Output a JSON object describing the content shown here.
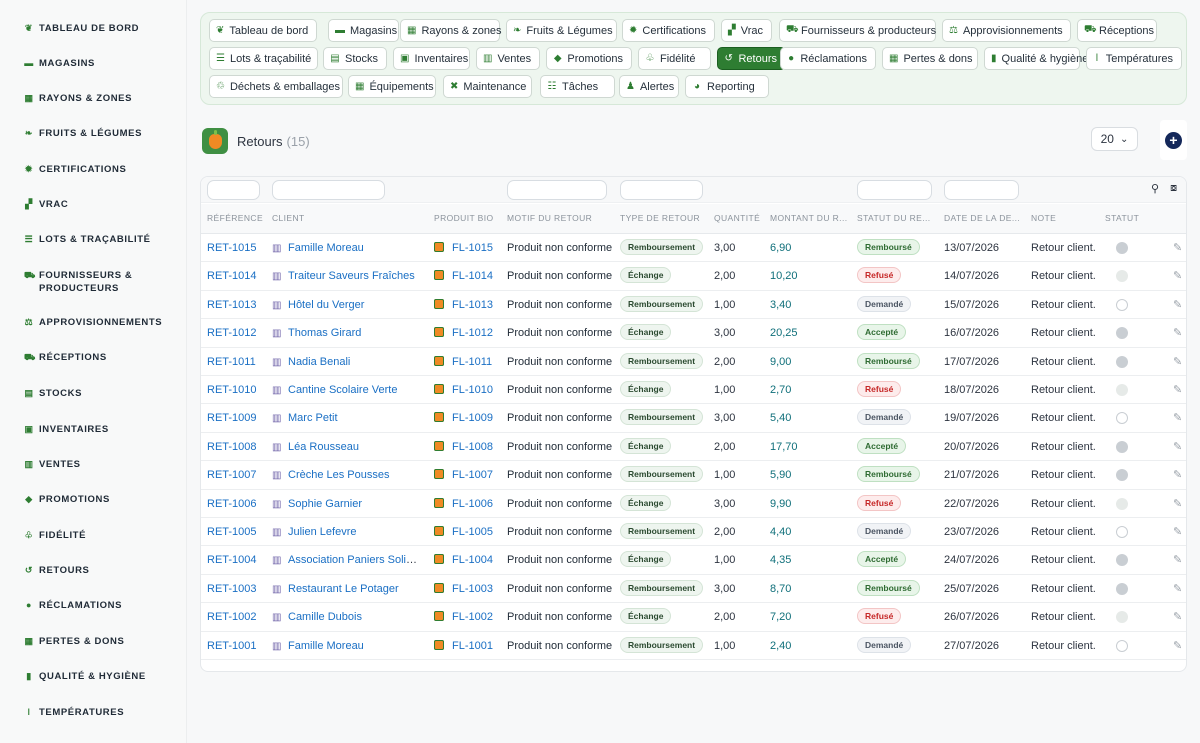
{
  "sidebar": {
    "items": [
      {
        "icon": "sprout-icon",
        "glyph": "❦",
        "label": "TABLEAU DE BORD"
      },
      {
        "icon": "store-icon",
        "glyph": "▬",
        "label": "MAGASINS"
      },
      {
        "icon": "grid-icon",
        "glyph": "▦",
        "label": "RAYONS & ZONES"
      },
      {
        "icon": "leaf-icon",
        "glyph": "❧",
        "label": "FRUITS & LÉGUMES"
      },
      {
        "icon": "badge-icon",
        "glyph": "✹",
        "label": "CERTIFICATIONS"
      },
      {
        "icon": "boxes-icon",
        "glyph": "▞",
        "label": "VRAC"
      },
      {
        "icon": "list-icon",
        "glyph": "☰",
        "label": "LOTS & TRAÇABILITÉ"
      },
      {
        "icon": "tractor-icon",
        "glyph": "⛟",
        "label": "FOURNISSEURS & PRODUCTEURS"
      },
      {
        "icon": "cart-icon",
        "glyph": "⚖",
        "label": "APPROVISIONNEMENTS"
      },
      {
        "icon": "truck-icon",
        "glyph": "⛟",
        "label": "RÉCEPTIONS"
      },
      {
        "icon": "warehouse-icon",
        "glyph": "▤",
        "label": "STOCKS"
      },
      {
        "icon": "clipboard-check-icon",
        "glyph": "▣",
        "label": "INVENTAIRES"
      },
      {
        "icon": "cash-icon",
        "glyph": "▥",
        "label": "VENTES"
      },
      {
        "icon": "tag-icon",
        "glyph": "◆",
        "label": "PROMOTIONS"
      },
      {
        "icon": "loyalty-icon",
        "glyph": "♧",
        "label": "FIDÉLITÉ"
      },
      {
        "icon": "undo-icon",
        "glyph": "↺",
        "label": "RETOURS"
      },
      {
        "icon": "comment-icon",
        "glyph": "●",
        "label": "RÉCLAMATIONS"
      },
      {
        "icon": "receipt-icon",
        "glyph": "▦",
        "label": "PERTES & DONS"
      },
      {
        "icon": "clipboard-icon",
        "glyph": "▮",
        "label": "QUALITÉ & HYGIÈNE"
      },
      {
        "icon": "thermometer-icon",
        "glyph": "ǀ",
        "label": "TEMPÉRATURES"
      }
    ]
  },
  "menu": {
    "chips": [
      {
        "icon": "sprout-icon",
        "glyph": "❦",
        "label": "Tableau de bord",
        "active": false
      },
      {
        "icon": "store-icon",
        "glyph": "▬",
        "label": "Magasins",
        "active": false
      },
      {
        "icon": "grid-icon",
        "glyph": "▦",
        "label": "Rayons & zones",
        "active": false
      },
      {
        "icon": "leaf-icon",
        "glyph": "❧",
        "label": "Fruits & Légumes",
        "active": false
      },
      {
        "icon": "badge-icon",
        "glyph": "✹",
        "label": "Certifications",
        "active": false
      },
      {
        "icon": "boxes-icon",
        "glyph": "▞",
        "label": "Vrac",
        "active": false
      },
      {
        "icon": "tractor-icon",
        "glyph": "⛟",
        "label": "Fournisseurs & producteurs",
        "active": false
      },
      {
        "icon": "cart-icon",
        "glyph": "⚖",
        "label": "Approvisionnements",
        "active": false
      },
      {
        "icon": "truck-icon",
        "glyph": "⛟",
        "label": "Réceptions",
        "active": false
      },
      {
        "icon": "list-icon",
        "glyph": "☰",
        "label": "Lots & traçabilité",
        "active": false
      },
      {
        "icon": "warehouse-icon",
        "glyph": "▤",
        "label": "Stocks",
        "active": false
      },
      {
        "icon": "clipboard-check-icon",
        "glyph": "▣",
        "label": "Inventaires",
        "active": false
      },
      {
        "icon": "cash-icon",
        "glyph": "▥",
        "label": "Ventes",
        "active": false
      },
      {
        "icon": "tag-icon",
        "glyph": "◆",
        "label": "Promotions",
        "active": false
      },
      {
        "icon": "loyalty-icon",
        "glyph": "♧",
        "label": "Fidélité",
        "active": false
      },
      {
        "icon": "undo-icon",
        "glyph": "↺",
        "label": "Retours",
        "active": true
      },
      {
        "icon": "comment-icon",
        "glyph": "●",
        "label": "Réclamations",
        "active": false
      },
      {
        "icon": "receipt-icon",
        "glyph": "▦",
        "label": "Pertes & dons",
        "active": false
      },
      {
        "icon": "clipboard-icon",
        "glyph": "▮",
        "label": "Qualité & hygiène",
        "active": false
      },
      {
        "icon": "thermometer-icon",
        "glyph": "ǀ",
        "label": "Températures",
        "active": false
      },
      {
        "icon": "recycle-icon",
        "glyph": "♲",
        "label": "Déchets & emballages",
        "active": false
      },
      {
        "icon": "equipment-icon",
        "glyph": "▦",
        "label": "Équipements",
        "active": false
      },
      {
        "icon": "tools-icon",
        "glyph": "✖",
        "label": "Maintenance",
        "active": false
      },
      {
        "icon": "tasks-icon",
        "glyph": "☷",
        "label": "Tâches",
        "active": false
      },
      {
        "icon": "bell-icon",
        "glyph": "♟",
        "label": "Alertes",
        "active": false
      },
      {
        "icon": "chart-pie-icon",
        "glyph": "◕",
        "label": "Reporting",
        "active": false
      }
    ]
  },
  "page": {
    "title": "Retours",
    "count": "(15)",
    "page_size": "20",
    "page_size_caret": "⌄",
    "add_glyph": "+"
  },
  "table": {
    "columns": [
      "Référence",
      "Client",
      "Produit bio",
      "Motif du retour",
      "Type de retour",
      "Quantité",
      "Montant du r...",
      "Statut du re...",
      "Date de la de...",
      "Note",
      "Statut"
    ],
    "rows": [
      {
        "ref": "RET-1015",
        "client": "Famille Moreau",
        "product": "FL-1015",
        "motif": "Produit non conforme",
        "type": "Remboursement",
        "qty": "3,00",
        "amount": "6,90",
        "status": "Remboursé",
        "status_kind": "rembourse",
        "date": "13/07/2026",
        "note": "Retour client.",
        "active": "grey"
      },
      {
        "ref": "RET-1014",
        "client": "Traiteur Saveurs Fraîches",
        "product": "FL-1014",
        "motif": "Produit non conforme",
        "type": "Échange",
        "qty": "2,00",
        "amount": "10,20",
        "status": "Refusé",
        "status_kind": "refuse",
        "date": "14/07/2026",
        "note": "Retour client.",
        "active": "light"
      },
      {
        "ref": "RET-1013",
        "client": "Hôtel du Verger",
        "product": "FL-1013",
        "motif": "Produit non conforme",
        "type": "Remboursement",
        "qty": "1,00",
        "amount": "3,40",
        "status": "Demandé",
        "status_kind": "demande",
        "date": "15/07/2026",
        "note": "Retour client.",
        "active": "empty"
      },
      {
        "ref": "RET-1012",
        "client": "Thomas Girard",
        "product": "FL-1012",
        "motif": "Produit non conforme",
        "type": "Échange",
        "qty": "3,00",
        "amount": "20,25",
        "status": "Accepté",
        "status_kind": "accepte",
        "date": "16/07/2026",
        "note": "Retour client.",
        "active": "grey"
      },
      {
        "ref": "RET-1011",
        "client": "Nadia Benali",
        "product": "FL-1011",
        "motif": "Produit non conforme",
        "type": "Remboursement",
        "qty": "2,00",
        "amount": "9,00",
        "status": "Remboursé",
        "status_kind": "rembourse",
        "date": "17/07/2026",
        "note": "Retour client.",
        "active": "grey"
      },
      {
        "ref": "RET-1010",
        "client": "Cantine Scolaire Verte",
        "product": "FL-1010",
        "motif": "Produit non conforme",
        "type": "Échange",
        "qty": "1,00",
        "amount": "2,70",
        "status": "Refusé",
        "status_kind": "refuse",
        "date": "18/07/2026",
        "note": "Retour client.",
        "active": "light"
      },
      {
        "ref": "RET-1009",
        "client": "Marc Petit",
        "product": "FL-1009",
        "motif": "Produit non conforme",
        "type": "Remboursement",
        "qty": "3,00",
        "amount": "5,40",
        "status": "Demandé",
        "status_kind": "demande",
        "date": "19/07/2026",
        "note": "Retour client.",
        "active": "empty"
      },
      {
        "ref": "RET-1008",
        "client": "Léa Rousseau",
        "product": "FL-1008",
        "motif": "Produit non conforme",
        "type": "Échange",
        "qty": "2,00",
        "amount": "17,70",
        "status": "Accepté",
        "status_kind": "accepte",
        "date": "20/07/2026",
        "note": "Retour client.",
        "active": "grey"
      },
      {
        "ref": "RET-1007",
        "client": "Crèche Les Pousses",
        "product": "FL-1007",
        "motif": "Produit non conforme",
        "type": "Remboursement",
        "qty": "1,00",
        "amount": "5,90",
        "status": "Remboursé",
        "status_kind": "rembourse",
        "date": "21/07/2026",
        "note": "Retour client.",
        "active": "grey"
      },
      {
        "ref": "RET-1006",
        "client": "Sophie Garnier",
        "product": "FL-1006",
        "motif": "Produit non conforme",
        "type": "Échange",
        "qty": "3,00",
        "amount": "9,90",
        "status": "Refusé",
        "status_kind": "refuse",
        "date": "22/07/2026",
        "note": "Retour client.",
        "active": "light"
      },
      {
        "ref": "RET-1005",
        "client": "Julien Lefevre",
        "product": "FL-1005",
        "motif": "Produit non conforme",
        "type": "Remboursement",
        "qty": "2,00",
        "amount": "4,40",
        "status": "Demandé",
        "status_kind": "demande",
        "date": "23/07/2026",
        "note": "Retour client.",
        "active": "empty"
      },
      {
        "ref": "RET-1004",
        "client": "Association Paniers Solid...",
        "product": "FL-1004",
        "motif": "Produit non conforme",
        "type": "Échange",
        "qty": "1,00",
        "amount": "4,35",
        "status": "Accepté",
        "status_kind": "accepte",
        "date": "24/07/2026",
        "note": "Retour client.",
        "active": "grey"
      },
      {
        "ref": "RET-1003",
        "client": "Restaurant Le Potager",
        "product": "FL-1003",
        "motif": "Produit non conforme",
        "type": "Remboursement",
        "qty": "3,00",
        "amount": "8,70",
        "status": "Remboursé",
        "status_kind": "rembourse",
        "date": "25/07/2026",
        "note": "Retour client.",
        "active": "grey"
      },
      {
        "ref": "RET-1002",
        "client": "Camille Dubois",
        "product": "FL-1002",
        "motif": "Produit non conforme",
        "type": "Échange",
        "qty": "2,00",
        "amount": "7,20",
        "status": "Refusé",
        "status_kind": "refuse",
        "date": "26/07/2026",
        "note": "Retour client.",
        "active": "light"
      },
      {
        "ref": "RET-1001",
        "client": "Famille Moreau",
        "product": "FL-1001",
        "motif": "Produit non conforme",
        "type": "Remboursement",
        "qty": "1,00",
        "amount": "2,40",
        "status": "Demandé",
        "status_kind": "demande",
        "date": "27/07/2026",
        "note": "Retour client.",
        "active": "empty"
      }
    ]
  }
}
